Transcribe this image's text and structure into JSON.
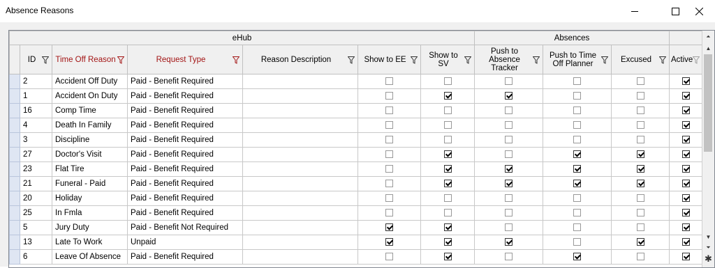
{
  "window": {
    "title": "Absence Reasons"
  },
  "bands": {
    "ehub": "eHub",
    "absences": "Absences"
  },
  "columns": [
    {
      "key": "id",
      "label": "ID",
      "red": false
    },
    {
      "key": "reason",
      "label": "Time Off Reason",
      "red": true
    },
    {
      "key": "type",
      "label": "Request Type",
      "red": true
    },
    {
      "key": "desc",
      "label": "Reason Description",
      "red": false
    },
    {
      "key": "ee",
      "label": "Show to EE",
      "red": false
    },
    {
      "key": "sv",
      "label": "Show to SV",
      "red": false
    },
    {
      "key": "tracker",
      "label": "Push to Absence Tracker",
      "red": false
    },
    {
      "key": "planner",
      "label": "Push to Time Off Planner",
      "red": false
    },
    {
      "key": "excused",
      "label": "Excused",
      "red": false
    },
    {
      "key": "active",
      "label": "Active",
      "red": false
    }
  ],
  "rows": [
    {
      "id": "2",
      "reason": "Accident Off Duty",
      "type": "Paid - Benefit Required",
      "desc": "",
      "ee": false,
      "sv": false,
      "tracker": false,
      "planner": false,
      "excused": false,
      "active": true
    },
    {
      "id": "1",
      "reason": "Accident On Duty",
      "type": "Paid - Benefit Required",
      "desc": "",
      "ee": false,
      "sv": true,
      "tracker": true,
      "planner": false,
      "excused": false,
      "active": true
    },
    {
      "id": "16",
      "reason": "Comp Time",
      "type": "Paid - Benefit Required",
      "desc": "",
      "ee": false,
      "sv": false,
      "tracker": false,
      "planner": false,
      "excused": false,
      "active": true
    },
    {
      "id": "4",
      "reason": "Death In Family",
      "type": "Paid - Benefit Required",
      "desc": "",
      "ee": false,
      "sv": false,
      "tracker": false,
      "planner": false,
      "excused": false,
      "active": true
    },
    {
      "id": "3",
      "reason": "Discipline",
      "type": "Paid - Benefit Required",
      "desc": "",
      "ee": false,
      "sv": false,
      "tracker": false,
      "planner": false,
      "excused": false,
      "active": true
    },
    {
      "id": "27",
      "reason": "Doctor's Visit",
      "type": "Paid - Benefit Required",
      "desc": "",
      "ee": false,
      "sv": true,
      "tracker": false,
      "planner": true,
      "excused": true,
      "active": true
    },
    {
      "id": "23",
      "reason": "Flat Tire",
      "type": "Paid - Benefit Required",
      "desc": "",
      "ee": false,
      "sv": true,
      "tracker": true,
      "planner": true,
      "excused": true,
      "active": true
    },
    {
      "id": "21",
      "reason": "Funeral - Paid",
      "type": "Paid - Benefit Required",
      "desc": "",
      "ee": false,
      "sv": true,
      "tracker": true,
      "planner": true,
      "excused": true,
      "active": true
    },
    {
      "id": "20",
      "reason": "Holiday",
      "type": "Paid - Benefit Required",
      "desc": "",
      "ee": false,
      "sv": false,
      "tracker": false,
      "planner": false,
      "excused": false,
      "active": true
    },
    {
      "id": "25",
      "reason": "In Fmla",
      "type": "Paid - Benefit Required",
      "desc": "",
      "ee": false,
      "sv": false,
      "tracker": false,
      "planner": false,
      "excused": false,
      "active": true
    },
    {
      "id": "5",
      "reason": "Jury Duty",
      "type": "Paid - Benefit Not Required",
      "desc": "",
      "ee": true,
      "sv": true,
      "tracker": false,
      "planner": false,
      "excused": false,
      "active": true
    },
    {
      "id": "13",
      "reason": "Late To Work",
      "type": "Unpaid",
      "desc": "",
      "ee": true,
      "sv": true,
      "tracker": true,
      "planner": false,
      "excused": true,
      "active": true
    },
    {
      "id": "6",
      "reason": "Leave Of Absence",
      "type": "Paid - Benefit Required",
      "desc": "",
      "ee": false,
      "sv": true,
      "tracker": false,
      "planner": true,
      "excused": false,
      "active": true
    }
  ],
  "icons": {
    "filter": "filter-funnel-icon",
    "minimize": "minimize-icon",
    "maximize": "maximize-icon",
    "close": "close-icon"
  },
  "colors": {
    "header_red": "#a31515",
    "selector": "#dfe6f3"
  }
}
